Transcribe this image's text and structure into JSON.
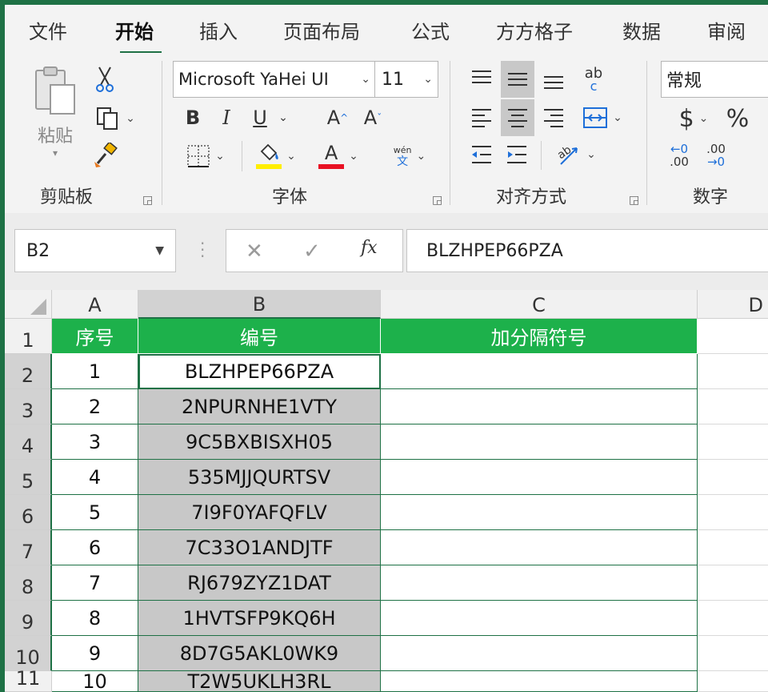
{
  "tabs": [
    "文件",
    "开始",
    "插入",
    "页面布局",
    "公式",
    "方方格子",
    "数据",
    "审阅"
  ],
  "active_tab": "开始",
  "clipboard": {
    "paste_label": "粘贴",
    "group_label": "剪贴板"
  },
  "font": {
    "name": "Microsoft YaHei UI",
    "size": "11",
    "bold": "B",
    "italic": "I",
    "underline": "U",
    "grow": "A",
    "shrink": "A",
    "font_color": "A",
    "phonetic_top": "wén",
    "phonetic_bottom": "文",
    "group_label": "字体",
    "fill_color": "#ffee00",
    "text_color": "#e81123"
  },
  "alignment": {
    "wrap_top": "ab",
    "wrap_bottom": "c",
    "group_label": "对齐方式"
  },
  "number": {
    "format": "常规",
    "currency": "$",
    "percent": "%",
    "inc_top": "←0",
    "inc_bottom": ".00",
    "dec_top": ".00",
    "dec_bottom": "→0",
    "group_label": "数字"
  },
  "formula_bar": {
    "name_box": "B2",
    "formula": "BLZHPEP66PZA"
  },
  "columns": [
    "A",
    "B",
    "C",
    "D"
  ],
  "rows": [
    "1",
    "2",
    "3",
    "4",
    "5",
    "6",
    "7",
    "8",
    "9",
    "10",
    "11"
  ],
  "header_row": [
    "序号",
    "编号",
    "加分隔符号"
  ],
  "data_rows": [
    [
      "1",
      "BLZHPEP66PZA"
    ],
    [
      "2",
      "2NPURNHE1VTY"
    ],
    [
      "3",
      "9C5BXBISXH05"
    ],
    [
      "4",
      "535MJJQURTSV"
    ],
    [
      "5",
      "7I9F0YAFQFLV"
    ],
    [
      "6",
      "7C33O1ANDJTF"
    ],
    [
      "7",
      "RJ679ZYZ1DAT"
    ],
    [
      "8",
      "1HVTSFP9KQ6H"
    ],
    [
      "9",
      "8D7G5AKL0WK9"
    ],
    [
      "10",
      "T2W5UKLH3RL"
    ]
  ],
  "colors": {
    "accent": "#1e7145",
    "header_fill": "#1db14b",
    "selection": "#c8c8c8"
  }
}
